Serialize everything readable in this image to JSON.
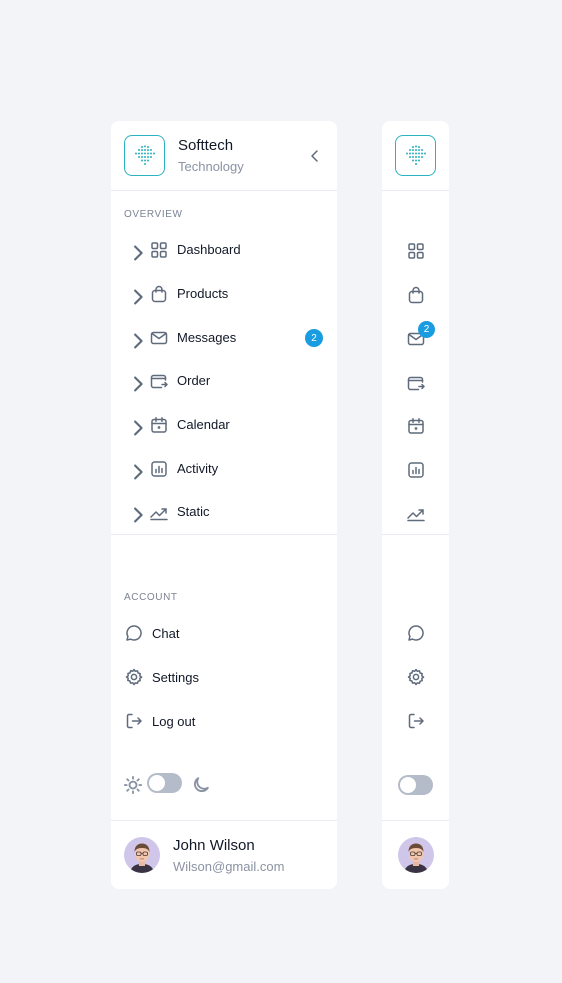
{
  "brand": {
    "name": "Softtech",
    "subtitle": "Technology"
  },
  "overview": {
    "label": "OVERVIEW",
    "items": [
      {
        "label": "Dashboard",
        "icon": "grid-icon"
      },
      {
        "label": "Products",
        "icon": "bag-icon"
      },
      {
        "label": "Messages",
        "icon": "mail-icon",
        "badge": "2"
      },
      {
        "label": "Order",
        "icon": "wallet-icon"
      },
      {
        "label": "Calendar",
        "icon": "calendar-icon"
      },
      {
        "label": "Activity",
        "icon": "chart-icon"
      },
      {
        "label": "Static",
        "icon": "trend-icon"
      }
    ]
  },
  "account": {
    "label": "ACCOUNT",
    "items": [
      {
        "label": "Chat",
        "icon": "chat-icon"
      },
      {
        "label": "Settings",
        "icon": "gear-icon"
      },
      {
        "label": "Log out",
        "icon": "logout-icon"
      }
    ]
  },
  "theme": {
    "mode": "light"
  },
  "user": {
    "name": "John Wilson",
    "email": "Wilson@gmail.com"
  },
  "colors": {
    "accent": "#1a9ce0",
    "logo": "#2bb3c0",
    "toggle_track": "#b5bcc9"
  }
}
